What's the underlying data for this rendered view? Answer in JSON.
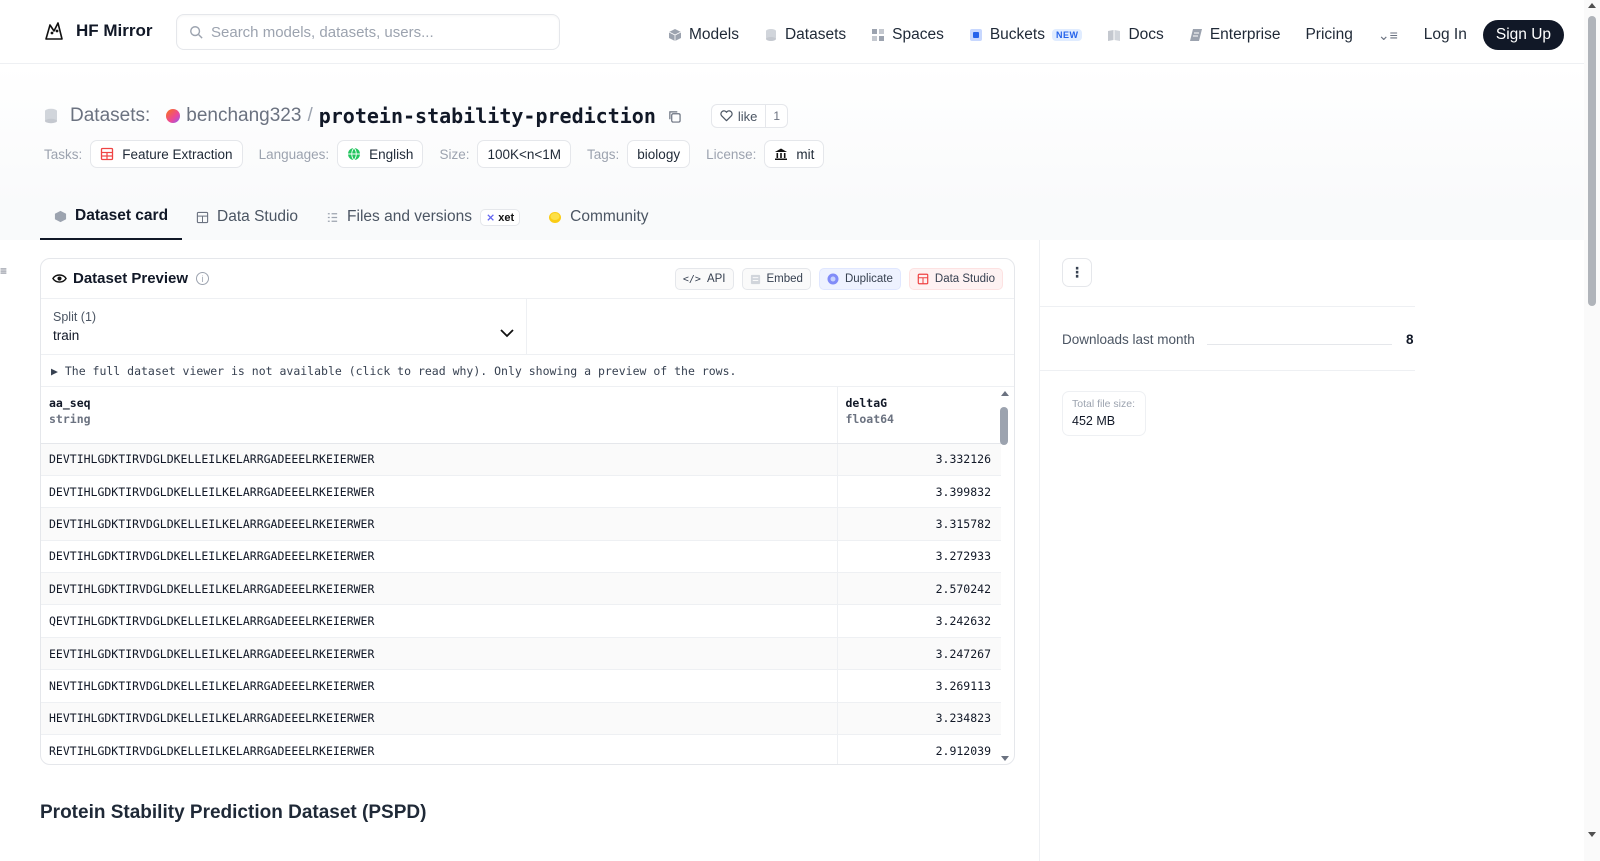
{
  "nav": {
    "brand": "HF Mirror",
    "search_placeholder": "Search models, datasets, users...",
    "links": [
      {
        "label": "Models",
        "icon": "cube-icon"
      },
      {
        "label": "Datasets",
        "icon": "database-icon"
      },
      {
        "label": "Spaces",
        "icon": "grid-icon"
      },
      {
        "label": "Buckets",
        "icon": "bucket-icon",
        "badge": "NEW"
      },
      {
        "label": "Docs",
        "icon": "book-icon"
      },
      {
        "label": "Enterprise",
        "icon": "enterprise-icon"
      },
      {
        "label": "Pricing"
      }
    ],
    "more_icon": "menu-icon",
    "login": "Log In",
    "signup": "Sign Up"
  },
  "repo": {
    "type_label": "Datasets:",
    "owner": "benchang323",
    "separator": "/",
    "name": "protein-stability-prediction",
    "like_label": "like",
    "like_count": "1"
  },
  "tags": {
    "tasks_label": "Tasks:",
    "task": "Feature Extraction",
    "languages_label": "Languages:",
    "language": "English",
    "size_label": "Size:",
    "size": "100K<n<1M",
    "tags_label": "Tags:",
    "tag": "biology",
    "license_label": "License:",
    "license": "mit"
  },
  "tabs": [
    {
      "label": "Dataset card",
      "active": true
    },
    {
      "label": "Data Studio"
    },
    {
      "label": "Files and versions",
      "badge": "xet"
    },
    {
      "label": "Community"
    }
  ],
  "preview": {
    "title": "Dataset Preview",
    "actions": {
      "api": "API",
      "embed": "Embed",
      "duplicate": "Duplicate",
      "data_studio": "Data Studio"
    },
    "split_label": "Split (1)",
    "split_value": "train",
    "notice": "▶ The full dataset viewer is not available (click to read why). Only showing a preview of the rows.",
    "columns": [
      {
        "name": "aa_seq",
        "type": "string"
      },
      {
        "name": "deltaG",
        "type": "float64"
      }
    ],
    "rows": [
      [
        "DEVTIHLGDKTIRVDGLDKELLEILKELARRGADEEELRKEIERWER",
        "3.332126"
      ],
      [
        "DEVTIHLGDKTIRVDGLDKELLEILKELARRGADEEELRKEIERWER",
        "3.399832"
      ],
      [
        "DEVTIHLGDKTIRVDGLDKELLEILKELARRGADEEELRKEIERWER",
        "3.315782"
      ],
      [
        "DEVTIHLGDKTIRVDGLDKELLEILKELARRGADEEELRKEIERWER",
        "3.272933"
      ],
      [
        "DEVTIHLGDKTIRVDGLDKELLEILKELARRGADEEELRKEIERWER",
        "2.570242"
      ],
      [
        "QEVTIHLGDKTIRVDGLDKELLEILKELARRGADEEELRKEIERWER",
        "3.242632"
      ],
      [
        "EEVTIHLGDKTIRVDGLDKELLEILKELARRGADEEELRKEIERWER",
        "3.247267"
      ],
      [
        "NEVTIHLGDKTIRVDGLDKELLEILKELARRGADEEELRKEIERWER",
        "3.269113"
      ],
      [
        "HEVTIHLGDKTIRVDGLDKELLEILKELARRGADEEELRKEIERWER",
        "3.234823"
      ],
      [
        "REVTIHLGDKTIRVDGLDKELLEILKELARRGADEEELRKEIERWER",
        "2.912039"
      ]
    ]
  },
  "section_heading": "Protein Stability Prediction Dataset (PSPD)",
  "sidebar": {
    "downloads_label": "Downloads last month",
    "downloads_value": "8",
    "file_size_label": "Total file size:",
    "file_size_value": "452 MB"
  }
}
